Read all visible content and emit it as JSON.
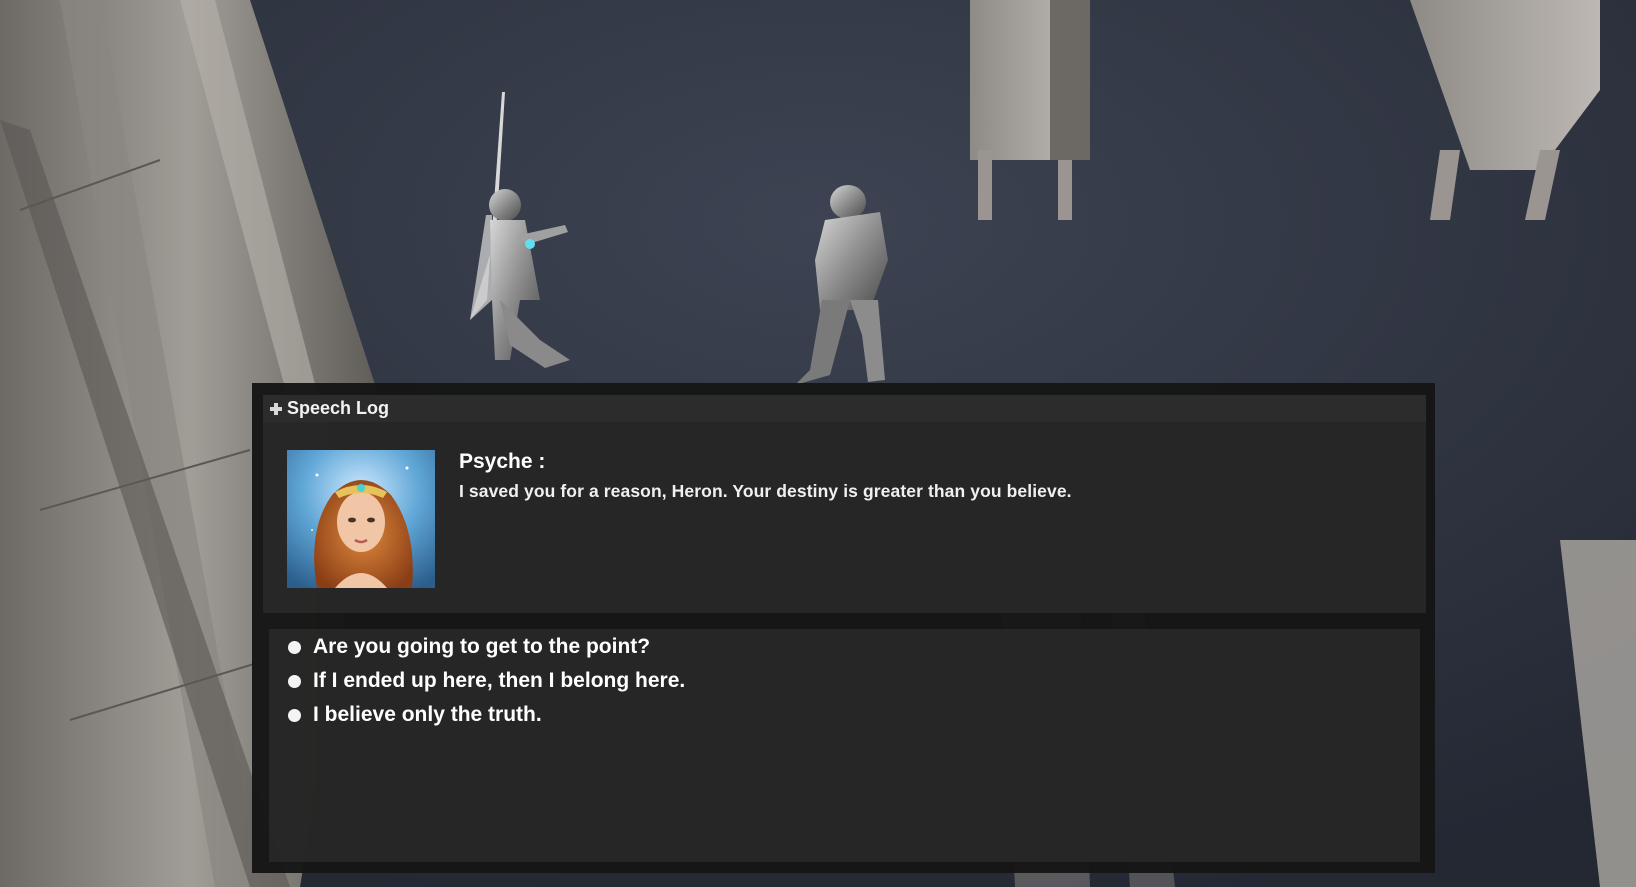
{
  "speech_log": {
    "title": "Speech Log",
    "icon": "plus-icon"
  },
  "dialogue": {
    "speaker": "Psyche :",
    "text": "I saved you for a reason, Heron. Your destiny is greater than you believe.",
    "portrait": "psyche-portrait"
  },
  "choices": [
    {
      "label": "Are you going to get to the point?"
    },
    {
      "label": "If I ended up here, then I belong here."
    },
    {
      "label": "I believe only the truth."
    }
  ]
}
